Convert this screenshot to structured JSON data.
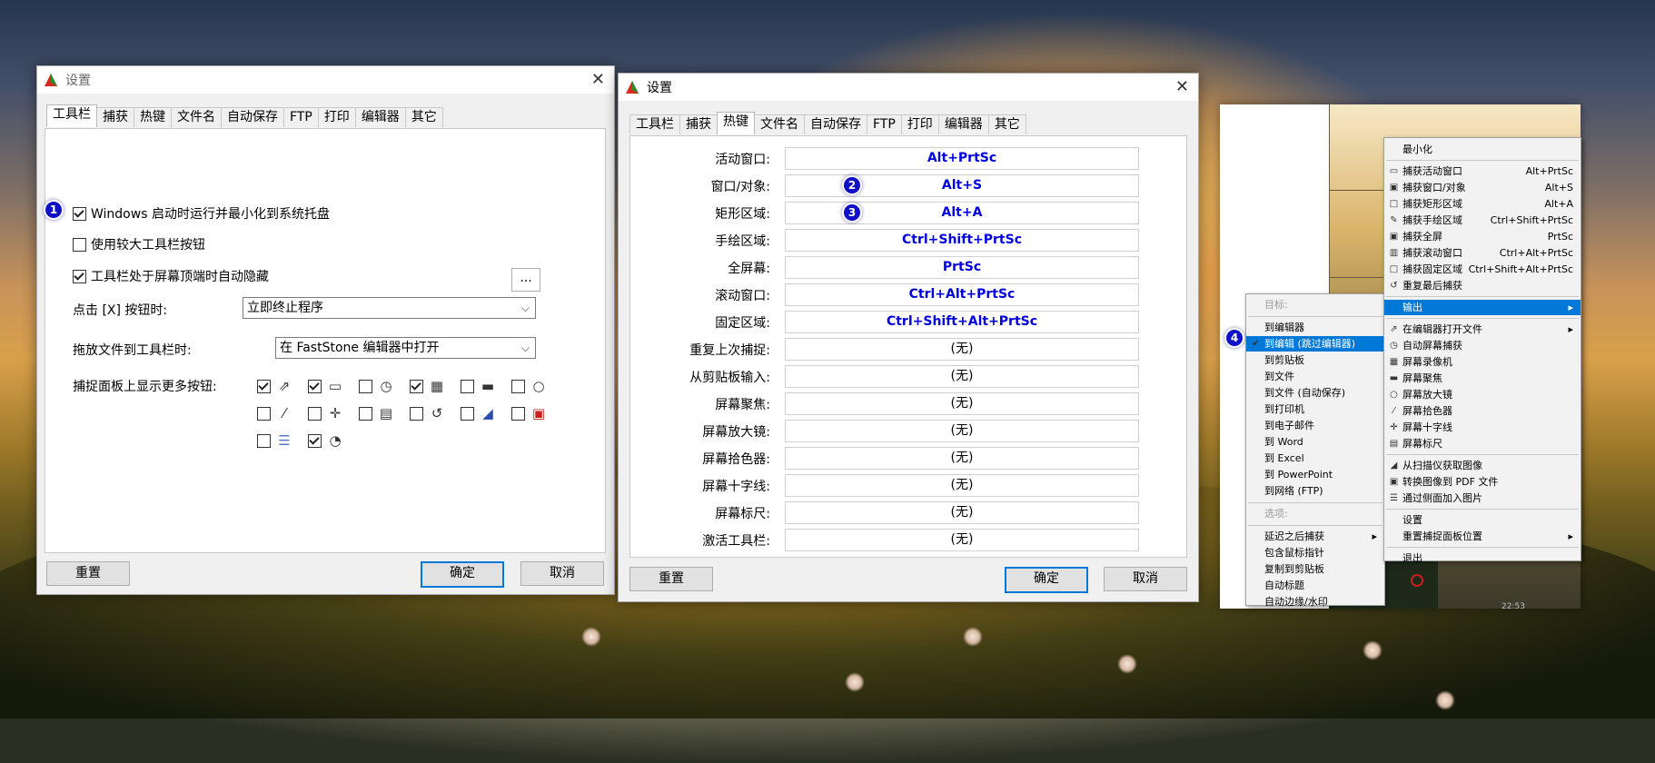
{
  "settings_a": {
    "title": "设置",
    "tabs": [
      "工具栏",
      "捕获",
      "热键",
      "文件名",
      "自动保存",
      "FTP",
      "打印",
      "编辑器",
      "其它"
    ],
    "badge": "1",
    "opt_startup": "Windows 启动时运行并最小化到系统托盘",
    "opt_large": "使用较大工具栏按钮",
    "opt_autohide": "工具栏处于屏幕顶端时自动隐藏",
    "more_btn": "...",
    "close_label": "点击 [X] 按钮时:",
    "close_value": "立即终止程序",
    "drop_label": "拖放文件到工具栏时:",
    "drop_value": "在 FastStone 编辑器中打开",
    "panel_label": "捕捉面板上显示更多按钮:",
    "reset": "重置",
    "ok": "确定",
    "cancel": "取消"
  },
  "settings_b": {
    "title": "设置",
    "tabs": [
      "工具栏",
      "捕获",
      "热键",
      "文件名",
      "自动保存",
      "FTP",
      "打印",
      "编辑器",
      "其它"
    ],
    "hotkeys": [
      {
        "label": "活动窗口:",
        "value": "Alt+PrtSc",
        "set": true
      },
      {
        "label": "窗口/对象:",
        "value": "Alt+S",
        "set": true,
        "badge": "2"
      },
      {
        "label": "矩形区域:",
        "value": "Alt+A",
        "set": true,
        "badge": "3"
      },
      {
        "label": "手绘区域:",
        "value": "Ctrl+Shift+PrtSc",
        "set": true
      },
      {
        "label": "全屏幕:",
        "value": "PrtSc",
        "set": true
      },
      {
        "label": "滚动窗口:",
        "value": "Ctrl+Alt+PrtSc",
        "set": true
      },
      {
        "label": "固定区域:",
        "value": "Ctrl+Shift+Alt+PrtSc",
        "set": true
      },
      {
        "label": "重复上次捕捉:",
        "value": "(无)",
        "set": false
      },
      {
        "label": "从剪贴板输入:",
        "value": "(无)",
        "set": false
      },
      {
        "label": "屏幕聚焦:",
        "value": "(无)",
        "set": false
      },
      {
        "label": "屏幕放大镜:",
        "value": "(无)",
        "set": false
      },
      {
        "label": "屏幕拾色器:",
        "value": "(无)",
        "set": false
      },
      {
        "label": "屏幕十字线:",
        "value": "(无)",
        "set": false
      },
      {
        "label": "屏幕标尺:",
        "value": "(无)",
        "set": false
      },
      {
        "label": "激活工具栏:",
        "value": "(无)",
        "set": false
      }
    ],
    "reset": "重置",
    "ok": "确定",
    "cancel": "取消"
  },
  "tray_menu": {
    "header": "最小化",
    "items": [
      {
        "label": "捕获活动窗口",
        "shortcut": "Alt+PrtSc"
      },
      {
        "label": "捕获窗口/对象",
        "shortcut": "Alt+S"
      },
      {
        "label": "捕获矩形区域",
        "shortcut": "Alt+A"
      },
      {
        "label": "捕获手绘区域",
        "shortcut": "Ctrl+Shift+PrtSc"
      },
      {
        "label": "捕获全屏",
        "shortcut": "PrtSc"
      },
      {
        "label": "捕获滚动窗口",
        "shortcut": "Ctrl+Alt+PrtSc"
      },
      {
        "label": "捕获固定区域",
        "shortcut": "Ctrl+Shift+Alt+PrtSc"
      },
      {
        "label": "重复最后捕获",
        "shortcut": ""
      }
    ],
    "output": "输出",
    "tools": [
      "在编辑器打开文件",
      "自动屏幕捕获",
      "屏幕录像机",
      "屏幕聚焦",
      "屏幕放大镜",
      "屏幕拾色器",
      "屏幕十字线",
      "屏幕标尺"
    ],
    "extra": [
      "从扫描仪获取图像",
      "转换图像到 PDF 文件",
      "通过侧面加入图片"
    ],
    "settings": "设置",
    "reset_panel": "重置捕捉面板位置",
    "exit": "退出"
  },
  "output_menu": {
    "target_header": "目标:",
    "targets": [
      "到编辑器",
      "到编辑 (跳过编辑器)",
      "到剪贴板",
      "到文件",
      "到文件 (自动保存)",
      "到打印机",
      "到电子邮件",
      "到 Word",
      "到 Excel",
      "到 PowerPoint",
      "到网络 (FTP)"
    ],
    "options_header": "选项:",
    "options": [
      "延迟之后捕获",
      "包含鼠标指针",
      "复制到剪贴板",
      "自动标题",
      "自动边缘/水印"
    ],
    "badge": "4"
  },
  "clock": "22:53"
}
